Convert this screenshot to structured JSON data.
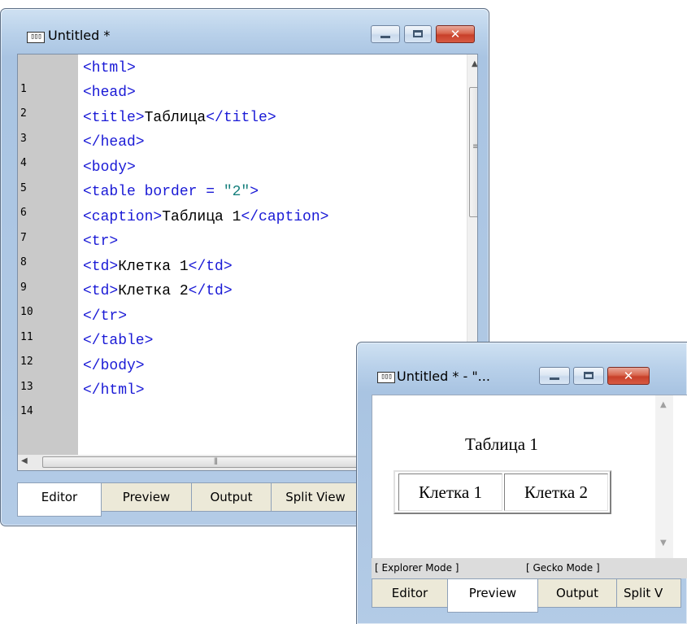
{
  "editor_window": {
    "title": "Untitled *",
    "line_numbers": [
      "1",
      "2",
      "3",
      "4",
      "5",
      "6",
      "7",
      "8",
      "9",
      "10",
      "11",
      "12",
      "13",
      "14"
    ],
    "code_lines": [
      [
        {
          "t": "tag",
          "v": "<html>"
        }
      ],
      [
        {
          "t": "tag",
          "v": "<head>"
        }
      ],
      [
        {
          "t": "tag",
          "v": "<title>"
        },
        {
          "t": "txt",
          "v": "Таблица"
        },
        {
          "t": "tag",
          "v": "</title>"
        }
      ],
      [
        {
          "t": "tag",
          "v": "</head>"
        }
      ],
      [
        {
          "t": "tag",
          "v": "<body>"
        }
      ],
      [
        {
          "t": "tag",
          "v": "<table border = "
        },
        {
          "t": "str",
          "v": "\"2\""
        },
        {
          "t": "tag",
          "v": ">"
        }
      ],
      [
        {
          "t": "tag",
          "v": "<caption>"
        },
        {
          "t": "txt",
          "v": "Таблица 1"
        },
        {
          "t": "tag",
          "v": "</caption>"
        }
      ],
      [
        {
          "t": "tag",
          "v": "<tr>"
        }
      ],
      [
        {
          "t": "tag",
          "v": "<td>"
        },
        {
          "t": "txt",
          "v": "Клетка 1"
        },
        {
          "t": "tag",
          "v": "</td>"
        }
      ],
      [
        {
          "t": "tag",
          "v": "<td>"
        },
        {
          "t": "txt",
          "v": "Клетка 2"
        },
        {
          "t": "tag",
          "v": "</td>"
        }
      ],
      [
        {
          "t": "tag",
          "v": "</tr>"
        }
      ],
      [
        {
          "t": "tag",
          "v": "</table>"
        }
      ],
      [
        {
          "t": "tag",
          "v": "</body>"
        }
      ],
      [
        {
          "t": "tag",
          "v": "</html>"
        }
      ]
    ],
    "tabs": [
      "Editor",
      "Preview",
      "Output",
      "Split View"
    ],
    "active_tab": "Editor"
  },
  "preview_window": {
    "title": "Untitled * - \"...",
    "rendered": {
      "caption": "Таблица 1",
      "cells": [
        "Клетка 1",
        "Клетка 2"
      ]
    },
    "modes": [
      "[ Explorer Mode ]",
      "[ Gecko Mode ]"
    ],
    "tabs": [
      "Editor",
      "Preview",
      "Output",
      "Split V"
    ],
    "active_tab": "Preview"
  },
  "icons": {
    "app": "notepad-app-icon",
    "minimize": "minimize-icon",
    "maximize": "maximize-icon",
    "close": "close-icon"
  },
  "colors": {
    "tag": "#1a1ad6",
    "string": "#17807d",
    "close_button": "#c8402a"
  }
}
